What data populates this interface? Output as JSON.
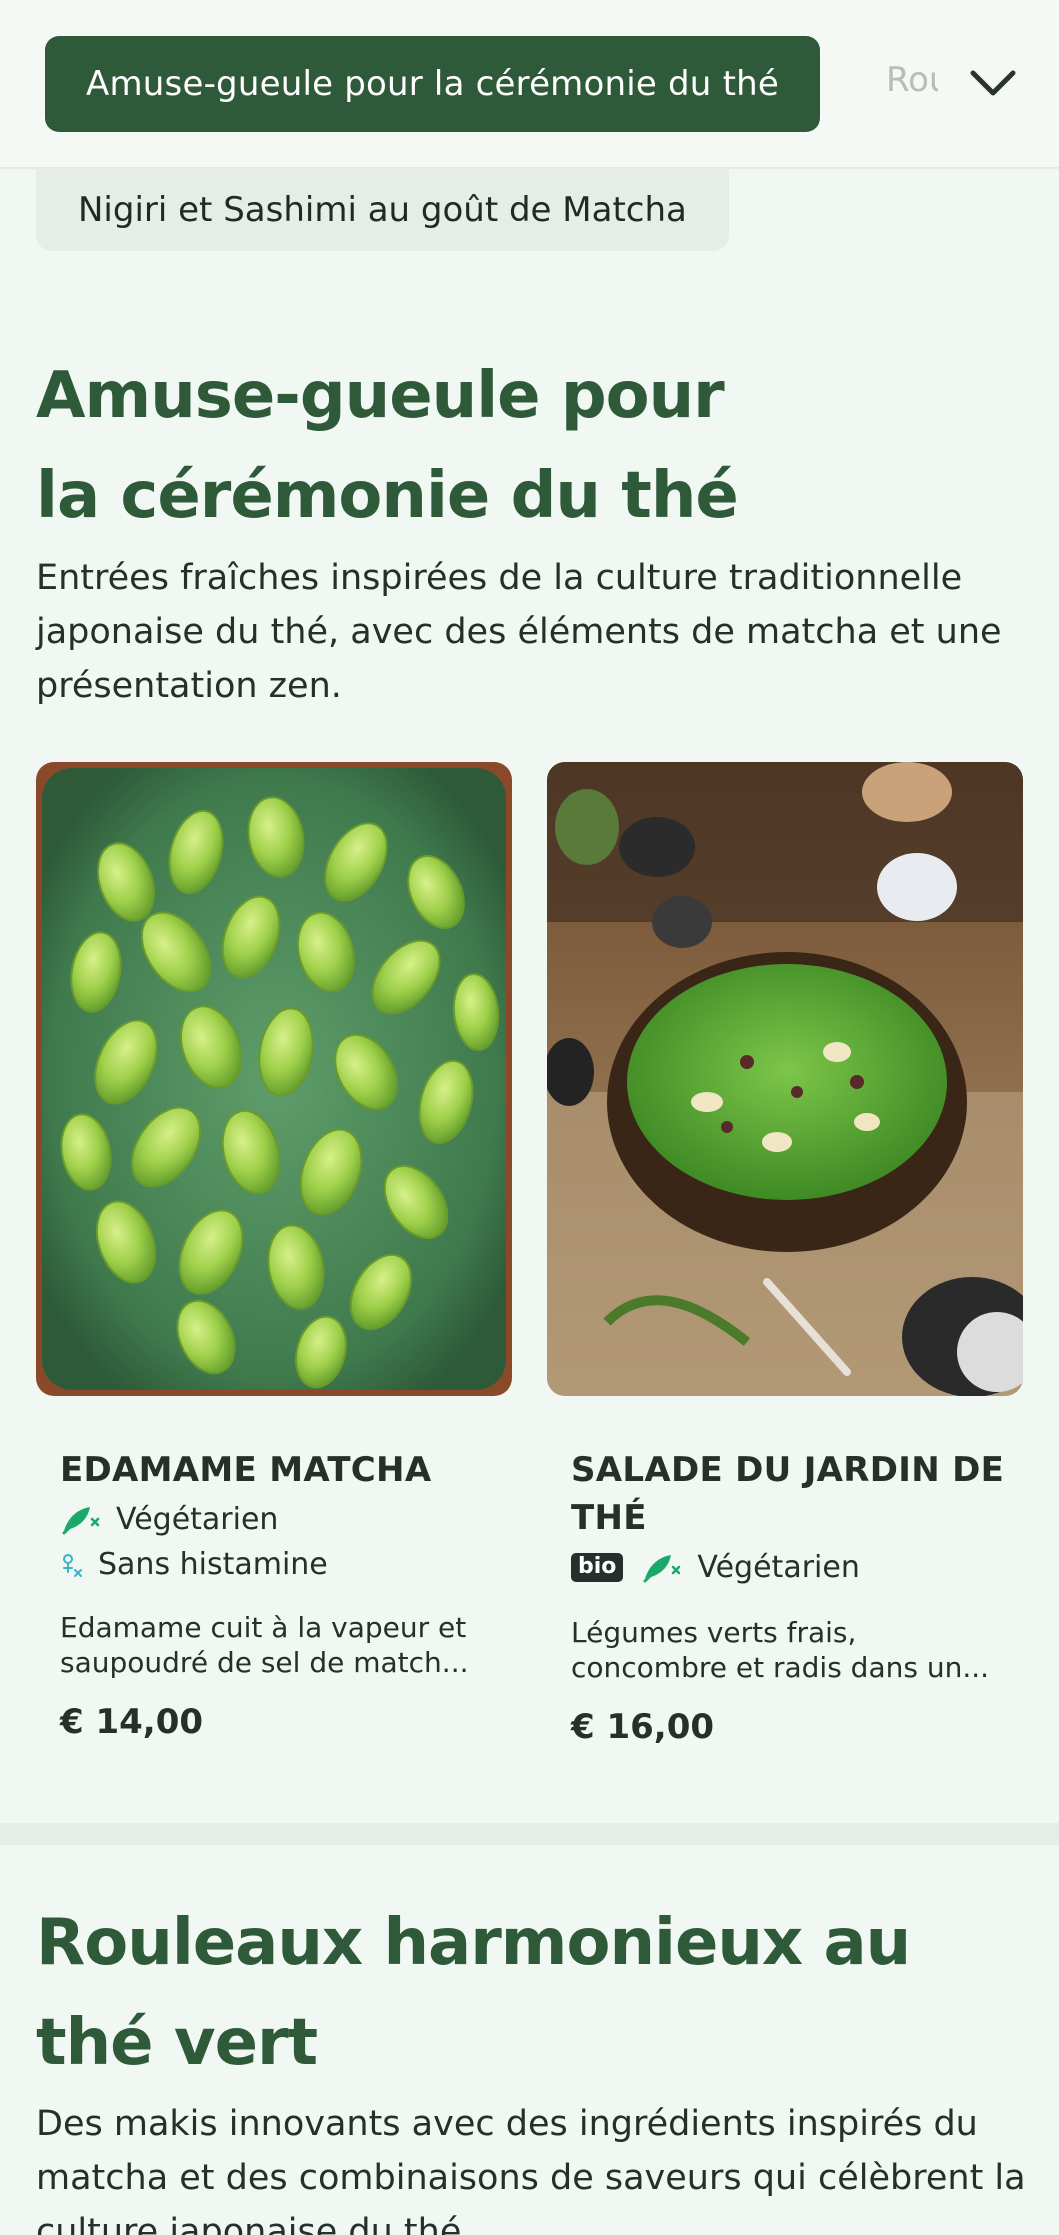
{
  "category_nav": {
    "active": "Amuse-gueule pour la cérémonie du thé",
    "next_partial": "Rouleaux harmonieux au thé vert",
    "secondary": "Nigiri et Sashimi au goût de Matcha"
  },
  "sections": [
    {
      "title": "Amuse-gueule pour la cérémonie du thé",
      "description": "Entrées fraîches inspirées de la culture traditionnelle japonaise du thé, avec des éléments de matcha et une présentation zen.",
      "items": [
        {
          "name": "EDAMAME MATCHA",
          "tags": [
            "Végétarien",
            "Sans histamine"
          ],
          "description": "Edamame cuit à la vapeur et saupoudré de sel de match...",
          "price": "€ 14,00"
        },
        {
          "name": "SALADE DU JARDIN DE THÉ",
          "badge": "bio",
          "tags": [
            "Végétarien"
          ],
          "description": "Légumes verts frais, concombre et radis dans un...",
          "price": "€ 16,00"
        }
      ]
    },
    {
      "title": "Rouleaux harmonieux au thé vert",
      "description": "Des makis innovants avec des ingrédients inspirés du matcha et des combinaisons de saveurs qui célèbrent la culture japonaise du thé."
    }
  ],
  "colors": {
    "brand": "#2f5a3a",
    "background": "#f1f7f2",
    "icon_green": "#1aa86b",
    "icon_teal": "#3bb3c4"
  }
}
